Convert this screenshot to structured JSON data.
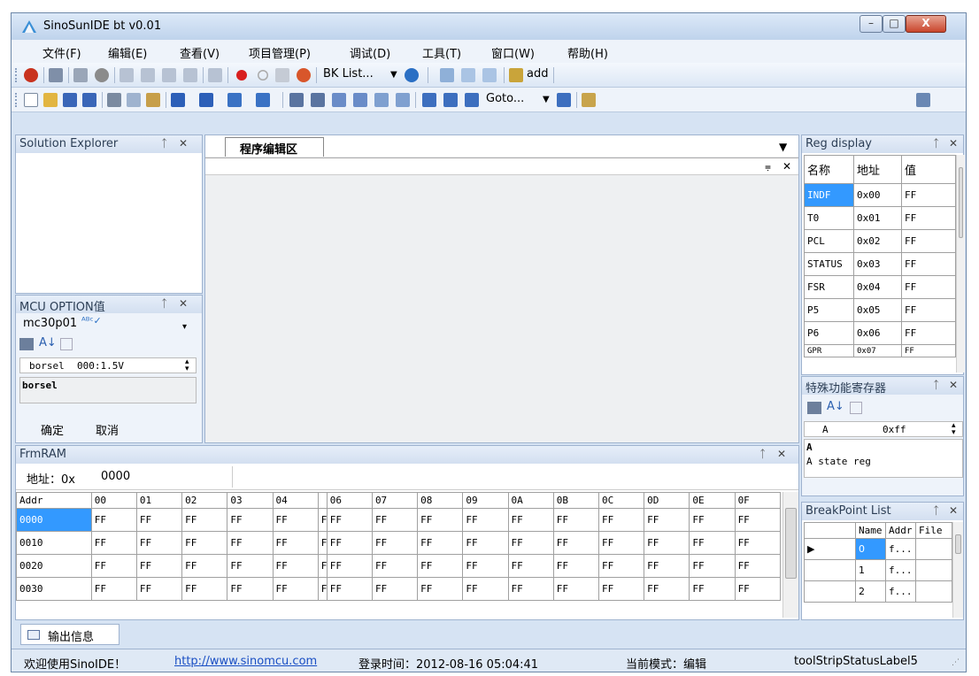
{
  "window": {
    "title": "SinoSunIDE bt v0.01",
    "min": "–",
    "max": "□",
    "close": "X"
  },
  "menu": [
    "文件(F)",
    "编辑(E)",
    "查看(V)",
    "项目管理(P)",
    "调试(D)",
    "工具(T)",
    "窗口(W)",
    "帮助(H)"
  ],
  "toolbar1": {
    "bk_list": "BK List...",
    "add": "add"
  },
  "toolbar2": {
    "goto": "Goto..."
  },
  "solution_explorer": {
    "title": "Solution Explorer",
    "pin": "ᵖ",
    "close": "✕"
  },
  "editor": {
    "tab": "程序编辑区",
    "dropdown": "▾",
    "pin": "▾",
    "close": "✕"
  },
  "mcu_option": {
    "title": "MCU OPTION值",
    "chip": "mc30p01",
    "prop_name": "borsel",
    "prop_value": "000:1.5V",
    "desc": "borsel",
    "ok": "确定",
    "cancel": "取消"
  },
  "reg_display": {
    "title": "Reg display",
    "headers": [
      "名称",
      "地址",
      "值"
    ],
    "rows": [
      [
        "INDF",
        "0x00",
        "FF"
      ],
      [
        "T0",
        "0x01",
        "FF"
      ],
      [
        "PCL",
        "0x02",
        "FF"
      ],
      [
        "STATUS",
        "0x03",
        "FF"
      ],
      [
        "FSR",
        "0x04",
        "FF"
      ],
      [
        "P5",
        "0x05",
        "FF"
      ],
      [
        "P6",
        "0x06",
        "FF"
      ],
      [
        "GPR",
        "0x07",
        "FF"
      ]
    ]
  },
  "sfr": {
    "title": "特殊功能寄存器",
    "prop_name": "A",
    "prop_value": "0xff",
    "desc_title": "A",
    "desc": "A state reg"
  },
  "breakpoints": {
    "title": "BreakPoint List",
    "headers": [
      "",
      "Name",
      "Addr",
      "File"
    ],
    "rows": [
      [
        "▶",
        "0",
        "f..."
      ],
      [
        "",
        "1",
        "f..."
      ],
      [
        "",
        "2",
        "f..."
      ]
    ]
  },
  "frmram": {
    "title": "FrmRAM",
    "addr_label": "地址：0x",
    "addr_value": "0000",
    "headers": [
      "Addr",
      "00",
      "01",
      "02",
      "03",
      "04",
      "",
      "06",
      "07",
      "08",
      "09",
      "0A",
      "0B",
      "0C",
      "0D",
      "0E",
      "0F"
    ],
    "rows": [
      [
        "0000",
        "FF",
        "FF",
        "FF",
        "FF",
        "FF",
        "F.",
        "FF",
        "FF",
        "FF",
        "FF",
        "FF",
        "FF",
        "FF",
        "FF",
        "FF",
        "FF"
      ],
      [
        "0010",
        "FF",
        "FF",
        "FF",
        "FF",
        "FF",
        "F.",
        "FF",
        "FF",
        "FF",
        "FF",
        "FF",
        "FF",
        "FF",
        "FF",
        "FF",
        "FF"
      ],
      [
        "0020",
        "FF",
        "FF",
        "FF",
        "FF",
        "FF",
        "F.",
        "FF",
        "FF",
        "FF",
        "FF",
        "FF",
        "FF",
        "FF",
        "FF",
        "FF",
        "FF"
      ],
      [
        "0030",
        "FF",
        "FF",
        "FF",
        "FF",
        "FF",
        "F.",
        "FF",
        "FF",
        "FF",
        "FF",
        "FF",
        "FF",
        "FF",
        "FF",
        "FF",
        "FF"
      ]
    ]
  },
  "output_tab": "输出信息",
  "status": {
    "welcome": "欢迎使用SinoIDE！",
    "url": "http://www.sinomcu.com",
    "login": "登录时间：2012-08-16 05:04:41",
    "mode": "当前模式：编辑",
    "label5": "toolStripStatusLabel5"
  },
  "colors": {
    "selection": "#3399ff",
    "menu_bg": "#eef3fa",
    "frame": "#d6e3f3",
    "close_red": "#c9452c"
  }
}
